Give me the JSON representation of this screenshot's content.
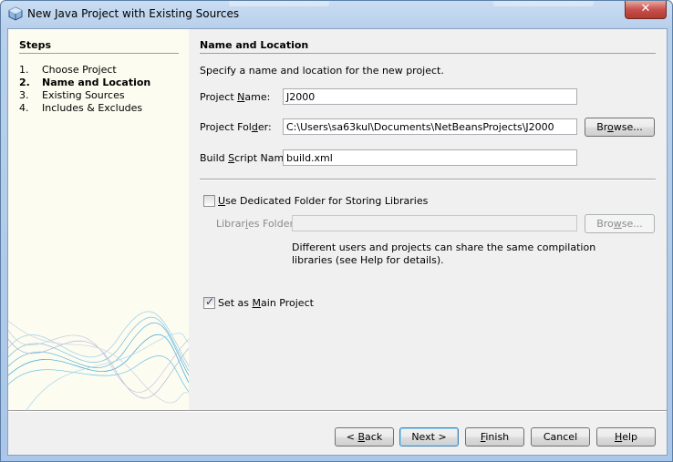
{
  "window": {
    "title": "New Java Project with Existing Sources",
    "close_glyph": "✕"
  },
  "steps": {
    "title": "Steps",
    "items": [
      {
        "num": "1.",
        "label": "Choose Project"
      },
      {
        "num": "2.",
        "label": "Name and Location"
      },
      {
        "num": "3.",
        "label": "Existing Sources"
      },
      {
        "num": "4.",
        "label": "Includes & Excludes"
      }
    ],
    "current_index": 1
  },
  "panel": {
    "title": "Name and Location",
    "description": "Specify a name and location for the new project."
  },
  "fields": {
    "project_name": {
      "label_pre": "Project ",
      "label_mn": "N",
      "label_post": "ame:",
      "value": "J2000"
    },
    "project_folder": {
      "label_pre": "Project Fol",
      "label_mn": "d",
      "label_post": "er:",
      "value": "C:\\Users\\sa63kul\\Documents\\NetBeansProjects\\J2000"
    },
    "build_script": {
      "label_pre": "Build ",
      "label_mn": "S",
      "label_post": "cript Name:",
      "value": "build.xml"
    },
    "libraries_folder": {
      "label_pre": "Librar",
      "label_mn": "i",
      "label_post": "es Folder:",
      "value": ""
    }
  },
  "browse_button": {
    "pre": "Br",
    "mn": "o",
    "post": "wse..."
  },
  "browse_libraries_button": {
    "pre": "Bro",
    "mn": "w",
    "post": "se..."
  },
  "dedicated_folder": {
    "checked": false,
    "pre": "",
    "mn": "U",
    "post": "se Dedicated Folder for Storing Libraries"
  },
  "libraries_note": {
    "line1": "Different users and projects can share the same compilation",
    "line2": "libraries (see Help for details)."
  },
  "main_project": {
    "checked": true,
    "pre": "Set as ",
    "mn": "M",
    "post": "ain Project",
    "tick": "✓"
  },
  "footer_buttons": {
    "back": {
      "pre": "< ",
      "mn": "B",
      "post": "ack"
    },
    "next": {
      "label": "Next >"
    },
    "finish": {
      "pre": "",
      "mn": "F",
      "post": "inish"
    },
    "cancel": {
      "label": "Cancel"
    },
    "help": {
      "pre": "",
      "mn": "H",
      "post": "elp"
    }
  },
  "colors": {
    "titlebar": "#b8d0ec",
    "close": "#c75050",
    "steps_bg": "#fcfcf0",
    "wave": "#3aa7d8"
  },
  "icons": {
    "title": "netbeans-cube-icon",
    "close": "close-icon"
  }
}
